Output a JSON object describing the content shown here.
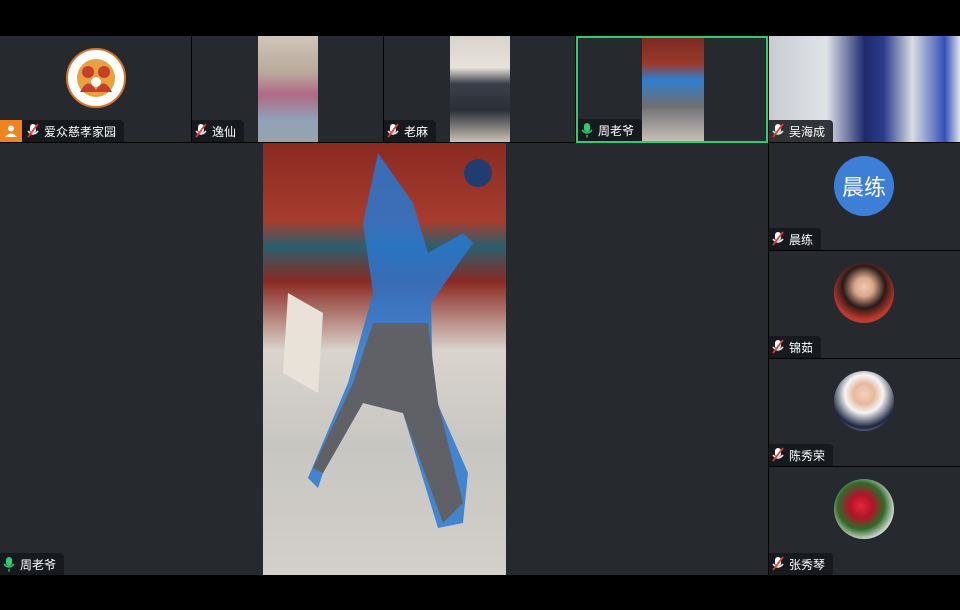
{
  "participants": {
    "p1": {
      "name": "爱众慈孝家园"
    },
    "p2": {
      "name": "逸仙"
    },
    "p3": {
      "name": "老麻"
    },
    "p4": {
      "name": "周老爷"
    },
    "p5": {
      "name": "吴海成"
    },
    "s1": {
      "name": "晨练",
      "initials": "晨练"
    },
    "s2": {
      "name": "锦茹"
    },
    "s3": {
      "name": "陈秀荣"
    },
    "s4": {
      "name": "张秀琴"
    }
  },
  "main": {
    "speaker_name": "周老爷"
  },
  "colors": {
    "active_border": "#2ecc71",
    "tile_bg": "#26292e",
    "avatar_blue": "#3d7fd6",
    "user_badge": "#f0831e"
  },
  "icons": {
    "mic_muted": "mic-muted-icon",
    "mic_active": "mic-active-icon",
    "user": "user-icon"
  }
}
